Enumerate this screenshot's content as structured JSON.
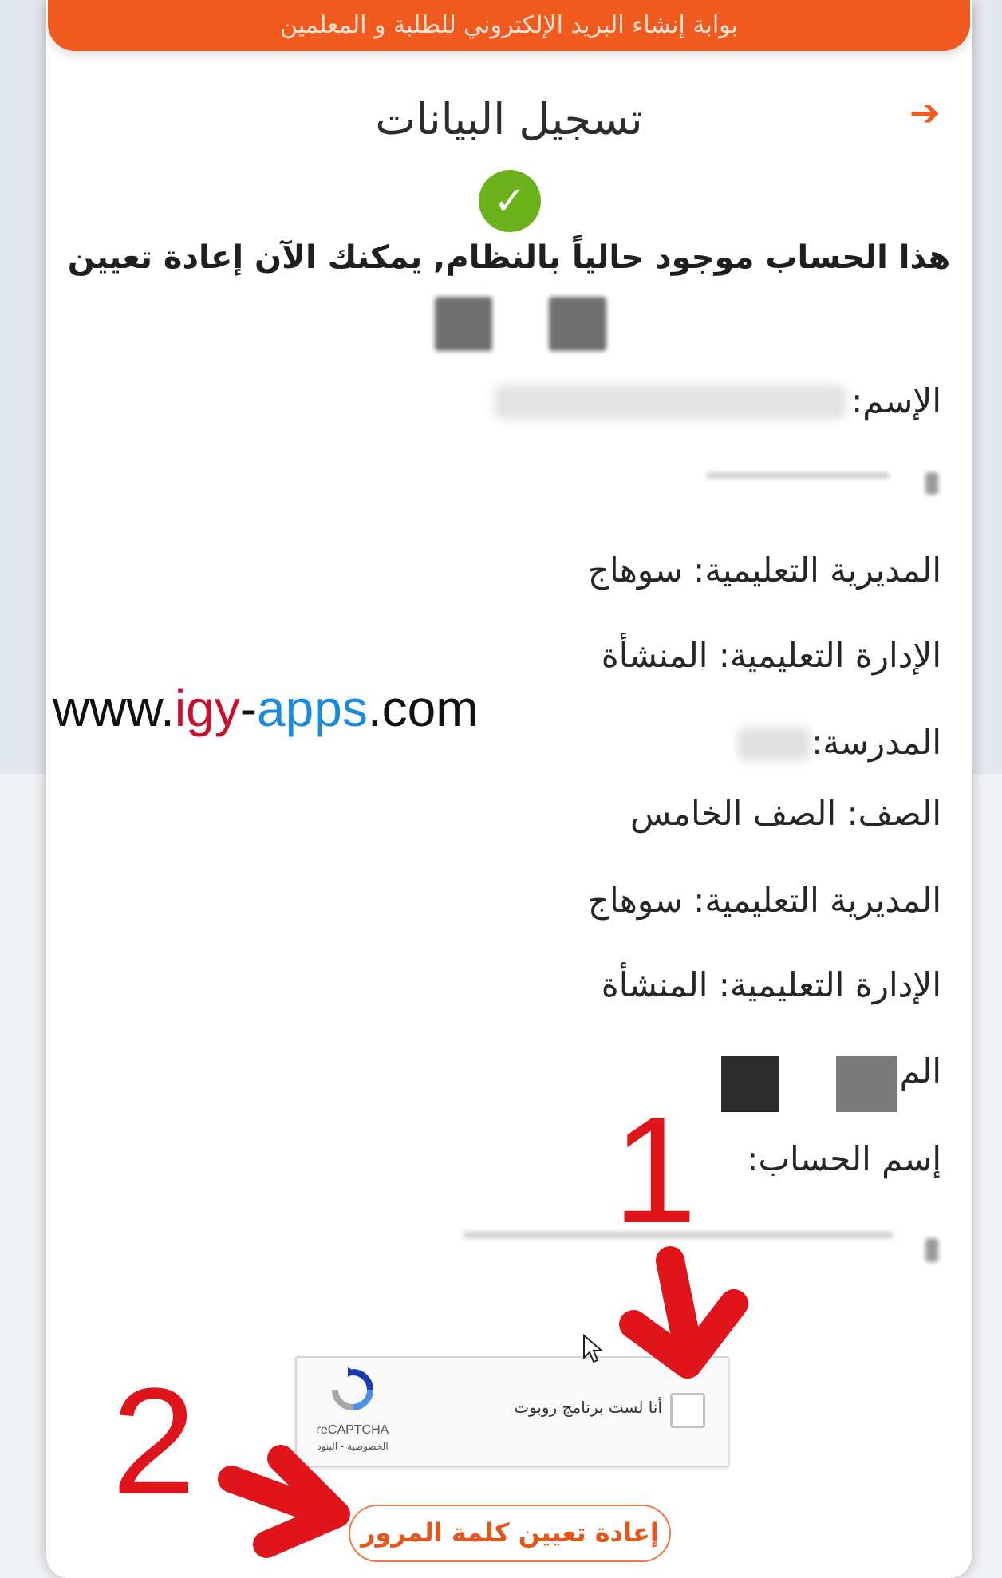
{
  "header": {
    "title": "بوابة إنشاء البريد الإلكتروني للطلبة و المعلمين"
  },
  "page": {
    "title": "تسجيل البيانات",
    "success_message": "هذا الحساب موجود حالياً بالنظام, يمكنك الآن إعادة تعيين",
    "back_icon": "arrow-right-icon",
    "check_icon": "check-circle-icon",
    "accent_color": "#f15a1f",
    "success_color": "#6bb21c"
  },
  "details": {
    "name_label": "الإسم:",
    "directorate_1": "المديرية التعليمية: سوهاج",
    "administration_1": "الإدارة التعليمية: المنشأة",
    "school_label": "المدرسة:",
    "grade": "الصف: الصف الخامس",
    "directorate_2": "المديرية التعليمية: سوهاج",
    "administration_2": "الإدارة التعليمية: المنشأة",
    "partial_label": "الم",
    "account_name_label": "إسم الحساب:"
  },
  "recaptcha": {
    "checkbox_label": "أنا لست برنامج روبوت",
    "brand": "reCAPTCHA",
    "privacy_terms": "الخصوصية - البنود"
  },
  "actions": {
    "reset_password_label": "إعادة تعيين كلمة المرور"
  },
  "watermark": {
    "part1": "www.",
    "part2": "igy",
    "part3": "-",
    "part4": "apps",
    "part5": ".com"
  },
  "annotations": {
    "step1": "1",
    "step2": "2",
    "arrow_color": "#e0141b"
  }
}
